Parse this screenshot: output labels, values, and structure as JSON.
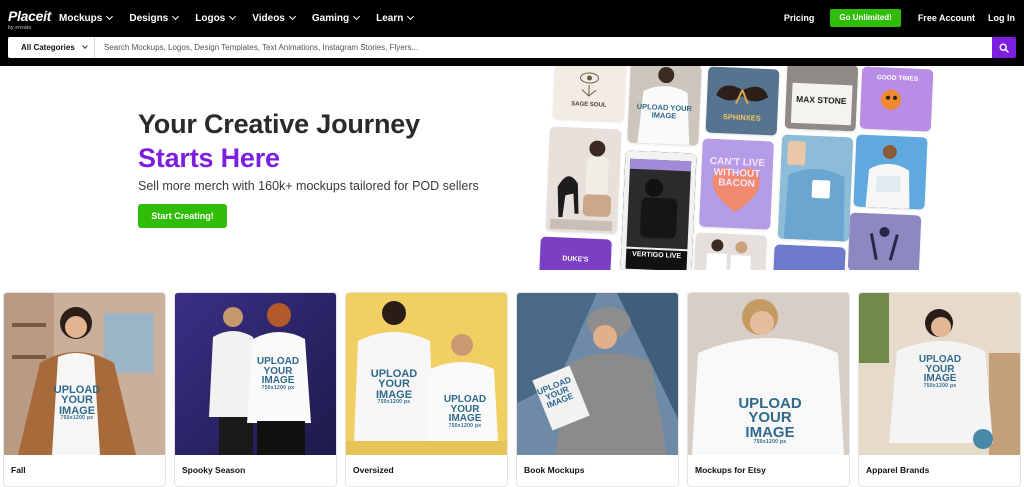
{
  "brand": {
    "name": "Placeit",
    "sub": "by envato"
  },
  "nav": {
    "menu": [
      "Mockups",
      "Designs",
      "Logos",
      "Videos",
      "Gaming",
      "Learn"
    ],
    "pricing": "Pricing",
    "unlimited": "Go Unlimited!",
    "free_account": "Free Account",
    "login": "Log In"
  },
  "search": {
    "category": "All Categories",
    "placeholder": "Search Mockups, Logos, Design Templates, Text Animations, Instagram Stories, Flyers..."
  },
  "hero": {
    "title": "Your Creative Journey",
    "subtitle": "Starts Here",
    "description": "Sell more merch with 160k+ mockups tailored for POD sellers",
    "cta": "Start Creating!"
  },
  "collage": {
    "tiles": [
      {
        "text": "SAGE SOUL"
      },
      {
        "text": "UPLOAD YOUR IMAGE"
      },
      {
        "text": "SPHINXES"
      },
      {
        "text": "MAX STONE"
      },
      {
        "text": "GOOD TIMES"
      },
      {
        "text": "CAN'T LIVE WITHOUT BACON"
      },
      {
        "text": "VERTIGO LIVE"
      },
      {
        "text": "DUKE'S"
      }
    ]
  },
  "upload_art": {
    "line1": "UPLOAD",
    "line2": "YOUR",
    "line3": "IMAGE",
    "size": "750x1200 px"
  },
  "categories": [
    {
      "label": "Fall"
    },
    {
      "label": "Spooky Season"
    },
    {
      "label": "Oversized"
    },
    {
      "label": "Book Mockups"
    },
    {
      "label": "Mockups for Etsy"
    },
    {
      "label": "Apparel Brands"
    }
  ],
  "colors": {
    "accent": "#7c1fe0",
    "cta": "#2fbd08",
    "topbar": "#000000"
  }
}
